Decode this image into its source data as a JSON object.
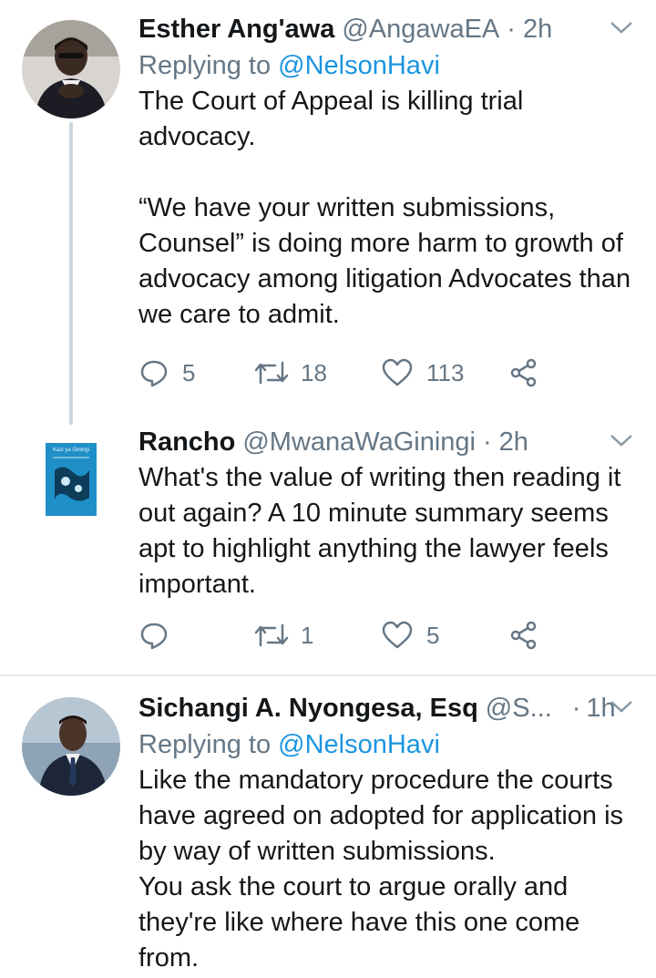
{
  "tweets": [
    {
      "name": "Esther Ang'awa",
      "handle": "@AngawaEA",
      "sep": "·",
      "time": "2h",
      "replying_prefix": "Replying to ",
      "replying_to": "@NelsonHavi",
      "body": "The Court of Appeal is killing trial advocacy.\n\n“We have your written submissions, Counsel” is doing more harm to growth of advocacy among litigation Advocates than we care to admit.",
      "counts": {
        "reply": "5",
        "retweet": "18",
        "like": "113"
      }
    },
    {
      "name": "Rancho",
      "handle": "@MwanaWaGiningi",
      "sep": "·",
      "time": "2h",
      "thumb_text": "Kazi ya Giningi",
      "body": "What's the value of writing then reading it out again? A 10 minute summary seems apt to highlight anything the lawyer feels important.",
      "counts": {
        "reply": "",
        "retweet": "1",
        "like": "5"
      }
    },
    {
      "name": "Sichangi A. Nyongesa, Esq",
      "handle": "@S...",
      "sep": "·",
      "time": "1h",
      "replying_prefix": "Replying to ",
      "replying_to": "@NelsonHavi",
      "body": "Like the mandatory procedure the courts have agreed on adopted for application is by way of written submissions.\nYou ask the court to argue orally and they're like where have this one come from."
    }
  ],
  "colors": {
    "accent": "#1b95e0",
    "muted": "#657786",
    "text": "#14171a",
    "divider": "#e6ecf0"
  }
}
